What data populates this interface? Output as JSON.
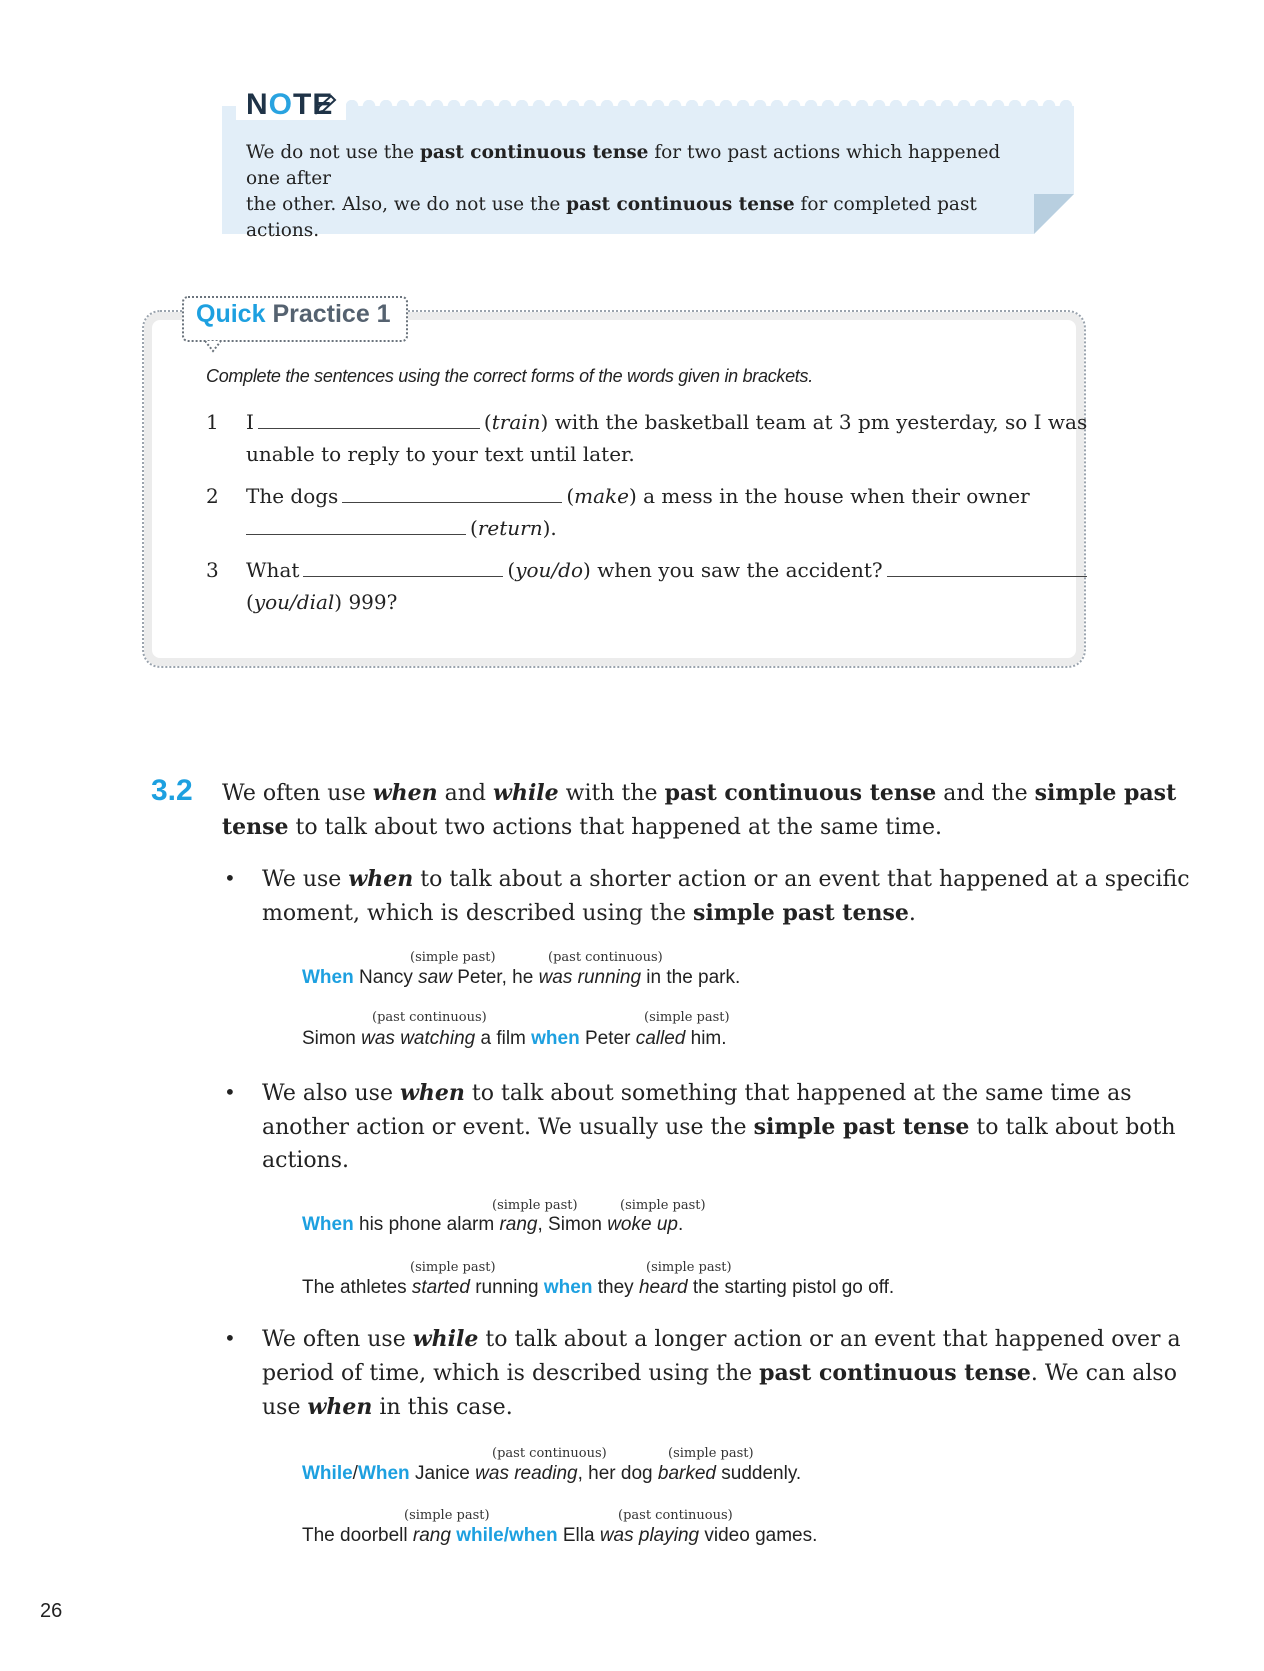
{
  "note": {
    "title_pre": "N",
    "title_o": "O",
    "title_post": "TE",
    "line1_a": "We do not use the ",
    "line1_b": "past continuous tense",
    "line1_c": " for two past actions which happened one after",
    "line2_a": "the other. Also, we do not use the ",
    "line2_b": "past continuous tense",
    "line2_c": " for completed past actions."
  },
  "quick_practice": {
    "title_a": "Quick",
    "title_b": "Practice 1",
    "instruction": "Complete the sentences using the correct forms of the words given in brackets.",
    "q1": {
      "num": "1",
      "a": "I",
      "b": "(",
      "b_it": "train",
      "c": ") with the basketball team at 3 pm yesterday, so I was",
      "line2": "unable to reply to your text until later."
    },
    "q2": {
      "num": "2",
      "a": "The dogs",
      "b_it": "make",
      "c": ") a mess in the house when their owner",
      "d_it": "return",
      "e": ")."
    },
    "q3": {
      "num": "3",
      "a": "What",
      "b_it": "you/do",
      "c": ") when you saw the accident?",
      "d_it": "you/dial",
      "e": ") 999?"
    }
  },
  "section": {
    "number": "3.2",
    "intro_1a": "We often use ",
    "intro_1b": "when",
    "intro_1c": " and ",
    "intro_1d": "while",
    "intro_1e": " with the ",
    "intro_1f": "past continuous tense",
    "intro_1g": " and the ",
    "intro_1h": "simple past",
    "intro_2a": "tense",
    "intro_2b": " to talk about two actions that happened at the same time.",
    "bullets": [
      {
        "l1a": "We use ",
        "l1b": "when",
        "l1c": " to talk about a shorter action or an event that happened at a specific",
        "l2a": "moment, which is described using the ",
        "l2b": "simple past tense",
        "l2c": "."
      },
      {
        "l1a": "We also use ",
        "l1b": "when",
        "l1c": " to talk about something that happened at the same time as",
        "l2a": "another action or event. We usually use the ",
        "l2b": "simple past tense",
        "l2c": " to talk about both",
        "l3": "actions."
      },
      {
        "l1a": "We often use ",
        "l1b": "while",
        "l1c": " to talk about a longer action or an event that happened over a",
        "l2a": "period of time, which is described using the ",
        "l2b": "past continuous tense",
        "l2c": ". We can also",
        "l3a": "use ",
        "l3b": "when",
        "l3c": " in this case."
      }
    ],
    "labels": {
      "simple_past": "(simple past)",
      "past_continuous": "(past continuous)"
    },
    "examples": {
      "e1": {
        "kw": "When",
        "a": " Nancy ",
        "saw": "saw",
        "b": " Peter, he ",
        "was_running": "was running",
        "c": " in the park."
      },
      "e2": {
        "a": "Simon ",
        "was_watching": "was watching",
        "b": " a film ",
        "kw": "when",
        "c": " Peter ",
        "called": "called",
        "d": " him."
      },
      "e3": {
        "kw": "When",
        "a": " his phone alarm ",
        "rang": "rang",
        "b": ", Simon ",
        "woke_up": "woke up",
        "c": "."
      },
      "e4": {
        "a": "The athletes ",
        "started": "started",
        "b": " running ",
        "kw": "when",
        "c": " they ",
        "heard": "heard",
        "d": " the starting pistol go off."
      },
      "e5": {
        "kw1": "While",
        "slash": "/",
        "kw2": "When",
        "a": " Janice ",
        "was_reading": "was reading",
        "b": ", her dog ",
        "barked": "barked",
        "c": " suddenly."
      },
      "e6": {
        "a": "The doorbell ",
        "rang": "rang",
        "sp": " ",
        "kw1": "while",
        "slash": "/",
        "kw2": "when",
        "b": " Ella ",
        "was_playing": "was playing",
        "c": " video games."
      }
    }
  },
  "page_number": "26",
  "colors": {
    "accent": "#1da0e0",
    "note_bg": "#e2eef8",
    "text": "#222222"
  }
}
